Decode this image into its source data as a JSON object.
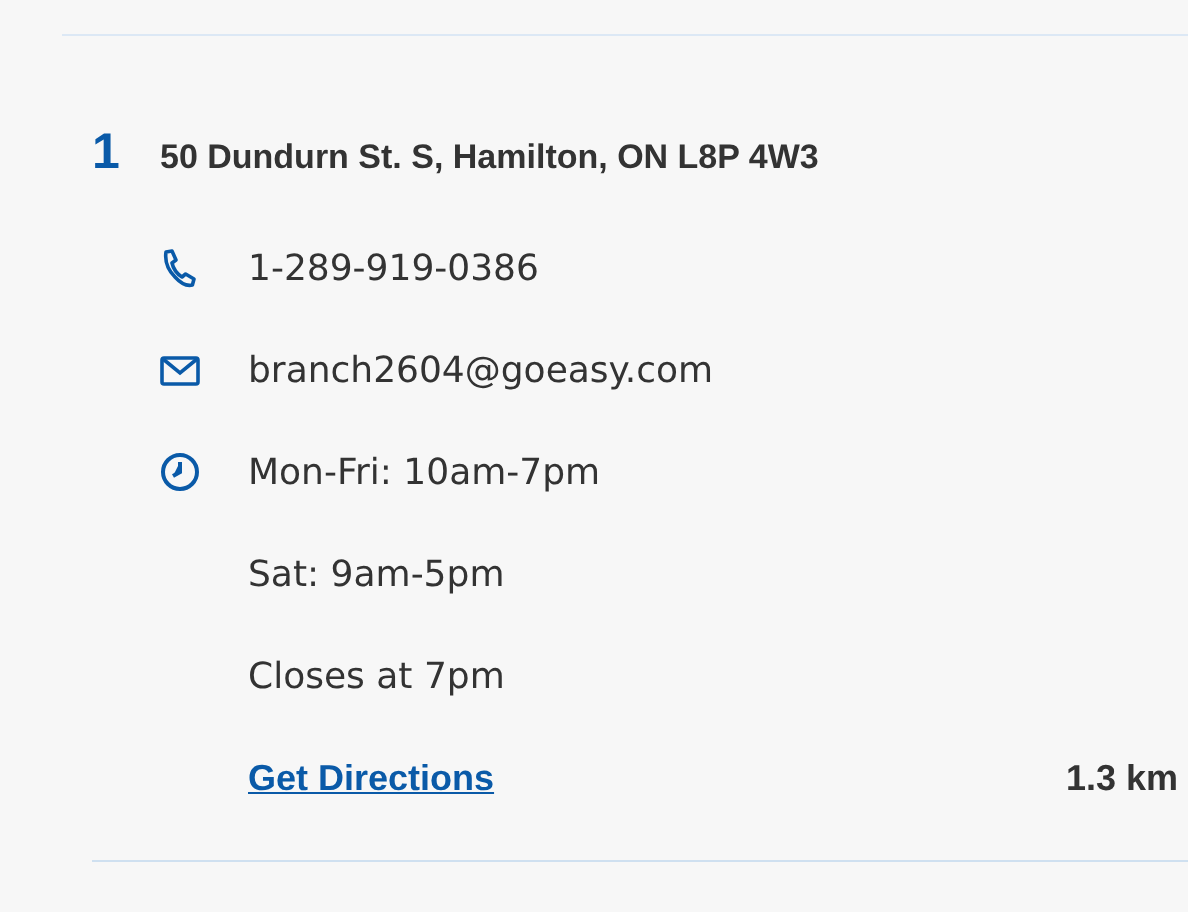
{
  "location": {
    "number": "1",
    "address": "50 Dundurn St. S, Hamilton, ON L8P 4W3",
    "details": [
      {
        "kind": "phone",
        "text": "1-289-919-0386"
      },
      {
        "kind": "email",
        "text": "branch2604@goeasy.com"
      },
      {
        "kind": "hours",
        "text": "Mon-Fri: 10am-7pm"
      },
      {
        "kind": "plain",
        "text": "Sat: 9am-5pm"
      },
      {
        "kind": "plain",
        "text": "Closes at 7pm"
      }
    ],
    "directions_link": "Get Directions",
    "distance": "1.3 km"
  }
}
